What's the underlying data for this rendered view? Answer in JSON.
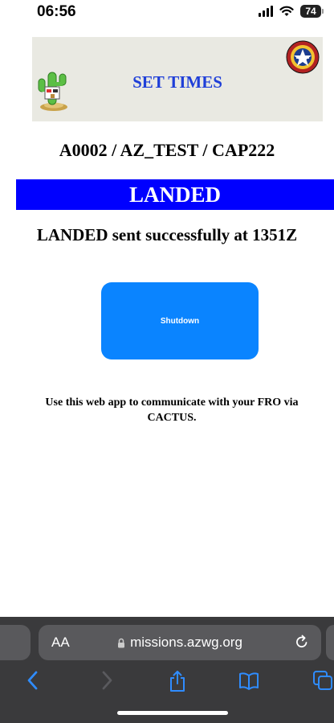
{
  "status_bar": {
    "time": "06:56",
    "battery": "74"
  },
  "header": {
    "title": "SET TIMES"
  },
  "mission": {
    "id_line": "A0002 / AZ_TEST / CAP222"
  },
  "status": {
    "label": "LANDED",
    "message": "LANDED sent successfully at 1351Z"
  },
  "actions": {
    "shutdown_label": "Shutdown"
  },
  "info": {
    "text": "Use this web app to communicate with your FRO via CACTUS."
  },
  "browser": {
    "text_size_label": "AA",
    "url": "missions.azwg.org"
  },
  "colors": {
    "banner_blue": "#0000ff",
    "button_blue": "#0a84ff",
    "title_blue": "#1f3fd8"
  }
}
